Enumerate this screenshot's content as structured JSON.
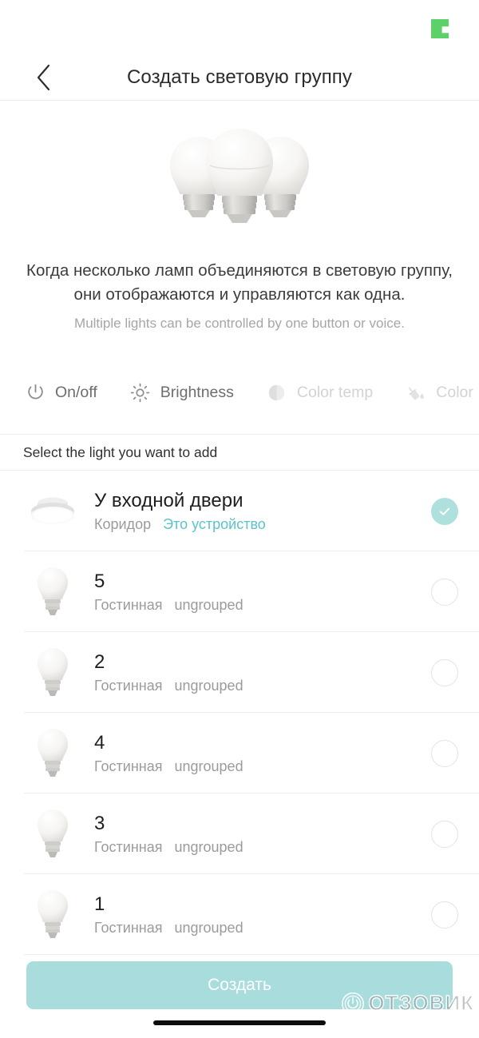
{
  "statusbar": {
    "badge_icon": "green-square-badge",
    "badge_color": "#5ed06a"
  },
  "navbar": {
    "back_icon": "chevron-left-icon",
    "title": "Создать световую группу"
  },
  "hero": {
    "illustration_icon": "three-light-bulbs-illustration",
    "description_ru": "Когда несколько ламп объединяются в световую группу, они отображаются и управляются как одна.",
    "description_en": "Multiple lights can be controlled by one button or voice."
  },
  "capabilities": [
    {
      "label": "On/off",
      "icon": "power-icon",
      "enabled": true
    },
    {
      "label": "Brightness",
      "icon": "sun-brightness-icon",
      "enabled": true
    },
    {
      "label": "Color temp",
      "icon": "half-circle-icon",
      "enabled": false
    },
    {
      "label": "Color",
      "icon": "paint-bucket-icon",
      "enabled": false
    }
  ],
  "section": {
    "label": "Select the light you want to add"
  },
  "devices": [
    {
      "name": "У входной двери",
      "room": "Коридор",
      "link": "Это устройство",
      "group": "",
      "icon": "ceiling-lamp-icon",
      "selected": true
    },
    {
      "name": "5",
      "room": "Гостинная",
      "group": "ungrouped",
      "link": "",
      "icon": "bulb-icon",
      "selected": false
    },
    {
      "name": "2",
      "room": "Гостинная",
      "group": "ungrouped",
      "link": "",
      "icon": "bulb-icon",
      "selected": false
    },
    {
      "name": "4",
      "room": "Гостинная",
      "group": "ungrouped",
      "link": "",
      "icon": "bulb-icon",
      "selected": false
    },
    {
      "name": "3",
      "room": "Гостинная",
      "group": "ungrouped",
      "link": "",
      "icon": "bulb-icon",
      "selected": false
    },
    {
      "name": "1",
      "room": "Гостинная",
      "group": "ungrouped",
      "link": "",
      "icon": "bulb-icon",
      "selected": false
    }
  ],
  "footer": {
    "cta_label": "Создать",
    "cta_color": "#a9dcdd",
    "watermark_text": "ОТЗОВИК",
    "watermark_icon": "power-button-logo-icon"
  },
  "colors": {
    "accent_teal": "#5cc3cb",
    "check_fill": "#aee0dd",
    "badge_green": "#5ed06a"
  }
}
